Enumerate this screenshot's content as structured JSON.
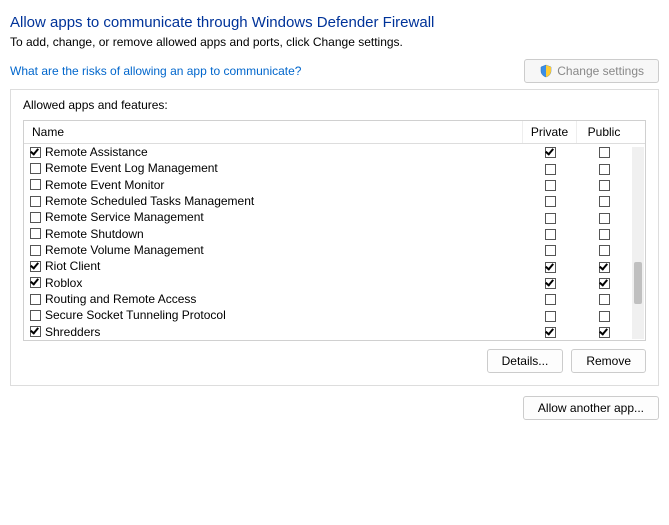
{
  "header": {
    "title": "Allow apps to communicate through Windows Defender Firewall",
    "subtitle": "To add, change, or remove allowed apps and ports, click Change settings.",
    "risks_link": "What are the risks of allowing an app to communicate?",
    "change_settings_label": "Change settings"
  },
  "panel": {
    "title": "Allowed apps and features:",
    "columns": {
      "name": "Name",
      "private": "Private",
      "public": "Public"
    },
    "rows": [
      {
        "name": "Remote Assistance",
        "enabled": true,
        "private": true,
        "public": false
      },
      {
        "name": "Remote Event Log Management",
        "enabled": false,
        "private": false,
        "public": false
      },
      {
        "name": "Remote Event Monitor",
        "enabled": false,
        "private": false,
        "public": false
      },
      {
        "name": "Remote Scheduled Tasks Management",
        "enabled": false,
        "private": false,
        "public": false
      },
      {
        "name": "Remote Service Management",
        "enabled": false,
        "private": false,
        "public": false
      },
      {
        "name": "Remote Shutdown",
        "enabled": false,
        "private": false,
        "public": false
      },
      {
        "name": "Remote Volume Management",
        "enabled": false,
        "private": false,
        "public": false
      },
      {
        "name": "Riot Client",
        "enabled": true,
        "private": true,
        "public": true
      },
      {
        "name": "Roblox",
        "enabled": true,
        "private": true,
        "public": true
      },
      {
        "name": "Routing and Remote Access",
        "enabled": false,
        "private": false,
        "public": false
      },
      {
        "name": "Secure Socket Tunneling Protocol",
        "enabled": false,
        "private": false,
        "public": false
      },
      {
        "name": "Shredders",
        "enabled": true,
        "private": true,
        "public": true
      }
    ],
    "details_label": "Details...",
    "remove_label": "Remove"
  },
  "footer": {
    "allow_another_label": "Allow another app..."
  }
}
